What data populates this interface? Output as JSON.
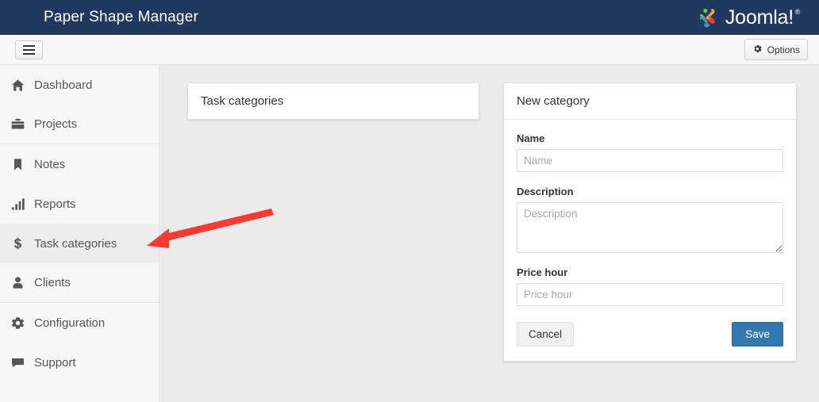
{
  "colors": {
    "brand_bar": "#21395f",
    "accent_primary": "#3277ad",
    "sidebar_bg": "#f7f7f7",
    "content_bg": "#ebebeb",
    "active_item_bg": "#ededed",
    "annotation_arrow": "#f93b34",
    "logo_orange": "#f9a541",
    "logo_green": "#7ac143",
    "logo_blue": "#5091cd",
    "logo_red": "#f44321"
  },
  "topbar": {
    "app_title": "Paper Shape Manager",
    "brand_text": "Joomla!",
    "brand_registered": "®",
    "brand_icon": "joomla-pinwheel-icon"
  },
  "toolbar": {
    "menu_toggle_icon": "hamburger-icon",
    "options_label": "Options",
    "options_icon": "gear-icon"
  },
  "sidebar": {
    "items": [
      {
        "label": "Dashboard",
        "icon": "home-icon",
        "active": false,
        "separator_below": false
      },
      {
        "label": "Projects",
        "icon": "briefcase-icon",
        "active": false,
        "separator_below": true
      },
      {
        "label": "Notes",
        "icon": "bookmark-icon",
        "active": false,
        "separator_below": false
      },
      {
        "label": "Reports",
        "icon": "bar-chart-icon",
        "active": false,
        "separator_below": false
      },
      {
        "label": "Task categories",
        "icon": "dollar-icon",
        "active": true,
        "separator_below": false
      },
      {
        "label": "Clients",
        "icon": "user-icon",
        "active": false,
        "separator_below": true
      },
      {
        "label": "Configuration",
        "icon": "gear-icon",
        "active": false,
        "separator_below": false
      },
      {
        "label": "Support",
        "icon": "comment-icon",
        "active": false,
        "separator_below": false
      }
    ]
  },
  "main": {
    "list_panel": {
      "title": "Task categories"
    },
    "form_panel": {
      "title": "New category",
      "fields": {
        "name": {
          "label": "Name",
          "value": "",
          "placeholder": "Name"
        },
        "description": {
          "label": "Description",
          "value": "",
          "placeholder": "Description"
        },
        "price_hour": {
          "label": "Price hour",
          "value": "",
          "placeholder": "Price hour"
        }
      },
      "cancel_label": "Cancel",
      "save_label": "Save"
    }
  },
  "annotation": {
    "type": "arrow",
    "points_to": "sidebar-item-task-categories"
  }
}
